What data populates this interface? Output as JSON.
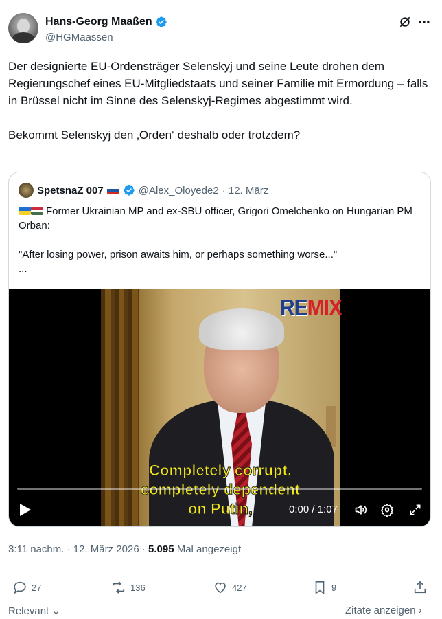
{
  "author": {
    "name": "Hans-Georg Maaßen",
    "handle": "@HGMaassen"
  },
  "tweet_text": "Der designierte EU-Ordensträger Selenskyj und seine Leute drohen dem Regierungschef eines EU-Mitgliedstaats und seiner Familie mit Ermordung – falls in Brüssel nicht im Sinne des Selenskyj-Regimes abgestimmt wird.\n\nBekommt Selenskyj den ‚Orden‘ deshalb oder trotzdem?",
  "quote": {
    "name": "SpetsnaZ 007",
    "handle": "@Alex_Oloyede2",
    "date": "· 12. März",
    "text_line1": "Former Ukrainian MP and ex-SBU officer, Grigori Omelchenko on Hungarian PM Orban:",
    "text_rest": "\"After losing power, prison awaits him, or perhaps something worse...\"\n...",
    "video": {
      "logo_re": "RE",
      "logo_mix": "MIX",
      "subtitle": "Completely corrupt,\ncompletely dependent\non Putin,",
      "time": "0:00 / 1:07",
      "progress": 0
    }
  },
  "meta": {
    "time": "3:11 nachm. · 12. März 2026 · ",
    "views": "5.095",
    "views_label": " Mal angezeigt"
  },
  "actions": {
    "replies": "27",
    "reposts": "136",
    "likes": "427",
    "bookmarks": "9"
  },
  "footer": {
    "relevant": "Relevant",
    "quotes": "Zitate anzeigen"
  },
  "colors": {
    "accent": "#1d9bf0",
    "secondary": "#536471",
    "subtitle": "#f2e81c"
  },
  "icons": [
    "verified-icon",
    "grok-icon",
    "more-icon",
    "play-icon",
    "volume-icon",
    "settings-icon",
    "fullscreen-icon",
    "reply-icon",
    "repost-icon",
    "like-icon",
    "bookmark-icon",
    "share-icon",
    "chevron-down-icon",
    "chevron-right-icon"
  ]
}
